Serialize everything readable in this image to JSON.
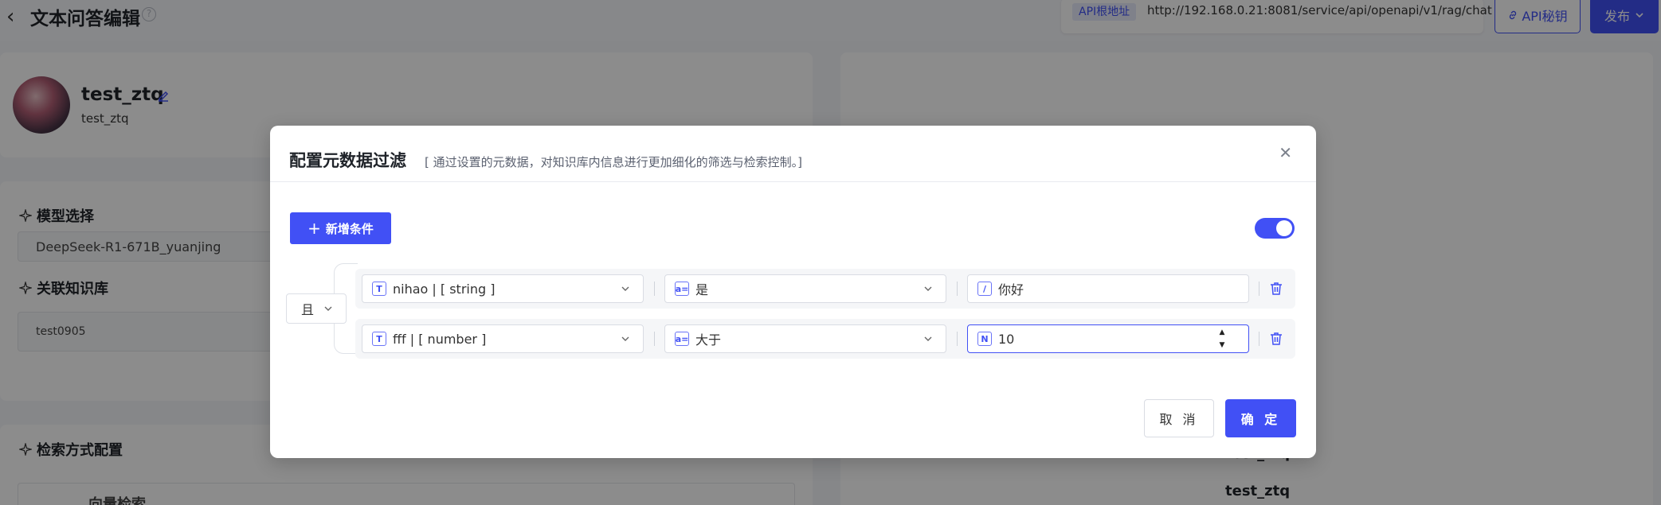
{
  "page": {
    "title": "文本问答编辑",
    "api_root_label": "API根地址",
    "api_root_url": "http://192.168.0.21:8081/service/api/openapi/v1/rag/chat",
    "api_secret_label": "API秘钥",
    "publish_label": "发布"
  },
  "profile": {
    "name": "test_ztq",
    "subtitle": "test_ztq"
  },
  "left": {
    "model_section": "模型选择",
    "model_value": "DeepSeek-R1-671B_yuanjing",
    "kb_section": "关联知识库",
    "kb_value": "test0905",
    "retrieval_section": "检索方式配置",
    "vector_search": "向量检索"
  },
  "right": {
    "names": [
      "test_ztq",
      "test_ztq"
    ]
  },
  "modal": {
    "title": "配置元数据过滤",
    "subtitle": "[ 通过设置的元数据，对知识库内信息进行更加细化的筛选与检索控制。]",
    "add_condition": "新增条件",
    "switch_on": true,
    "logic": "且",
    "conditions": [
      {
        "field_icon": "T",
        "field": "nihao | [ string ]",
        "operator": "是",
        "value_icon": "/",
        "value": "你好"
      },
      {
        "field_icon": "T",
        "field": "fff | [ number ]",
        "operator": "大于",
        "value_icon": "N",
        "value": "10"
      }
    ],
    "cancel": "取 消",
    "confirm": "确 定"
  },
  "colors": {
    "primary": "#4150f5",
    "overlay": "rgba(0,0,0,0.45)"
  }
}
